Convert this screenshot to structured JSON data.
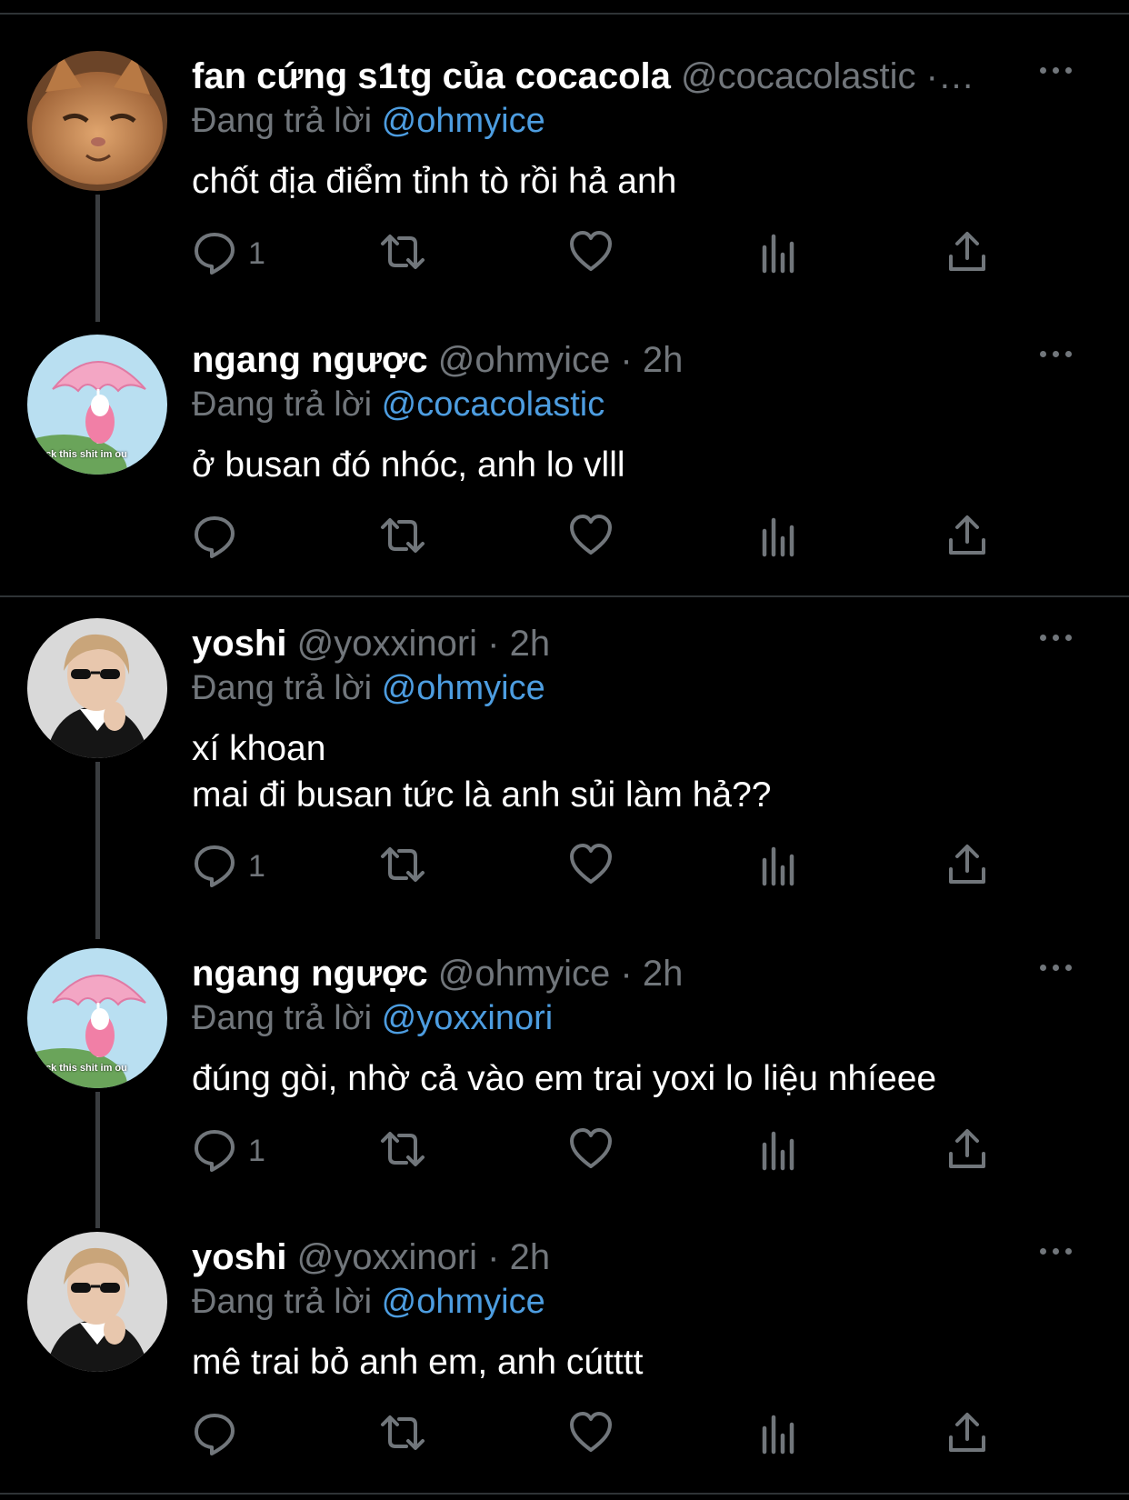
{
  "tweets": [
    {
      "name": "fan cứng s1tg của cocacola",
      "handle": "@cocacolastic ·…",
      "reply_label": "Đang trả lời",
      "reply_to": "@ohmyice",
      "text": [
        "chốt địa điểm tỉnh tò rồi hả anh"
      ],
      "reply_count": "1",
      "avatar_icon": "cat-avatar"
    },
    {
      "name": "ngang ngược",
      "handle": "@ohmyice · 2h",
      "reply_label": "Đang trả lời",
      "reply_to": "@cocacolastic",
      "text": [
        "ở busan đó nhóc, anh lo vlll"
      ],
      "reply_count": "",
      "avatar_icon": "umbrella-bunny-avatar",
      "avatar_caption": "ck this shit im ou"
    },
    {
      "name": "yoshi",
      "handle": "@yoxxinori · 2h",
      "reply_label": "Đang trả lời",
      "reply_to": "@ohmyice",
      "text": [
        "xí khoan",
        "mai đi busan tức là anh sủi làm hả??"
      ],
      "reply_count": "1",
      "avatar_icon": "person-sunglasses-avatar"
    },
    {
      "name": "ngang ngược",
      "handle": "@ohmyice · 2h",
      "reply_label": "Đang trả lời",
      "reply_to": "@yoxxinori",
      "text": [
        "đúng gòi, nhờ cả vào em trai yoxi lo liệu nhíeee"
      ],
      "reply_count": "1",
      "avatar_icon": "umbrella-bunny-avatar",
      "avatar_caption": "ck this shit im ou"
    },
    {
      "name": "yoshi",
      "handle": "@yoxxinori · 2h",
      "reply_label": "Đang trả lời",
      "reply_to": "@ohmyice",
      "text": [
        "mê trai bỏ anh em, anh cútttt"
      ],
      "reply_count": "",
      "avatar_icon": "person-sunglasses-avatar"
    }
  ],
  "icons": {
    "reply": "reply-bubble-icon",
    "retweet": "retweet-icon",
    "like": "heart-icon",
    "views": "analytics-icon",
    "share": "share-icon",
    "more": "more-dots-icon"
  },
  "colors": {
    "background": "#000000",
    "name": "#ffffff",
    "secondary": "#71767b",
    "link": "#4d9de0",
    "separator": "#2f3336"
  }
}
